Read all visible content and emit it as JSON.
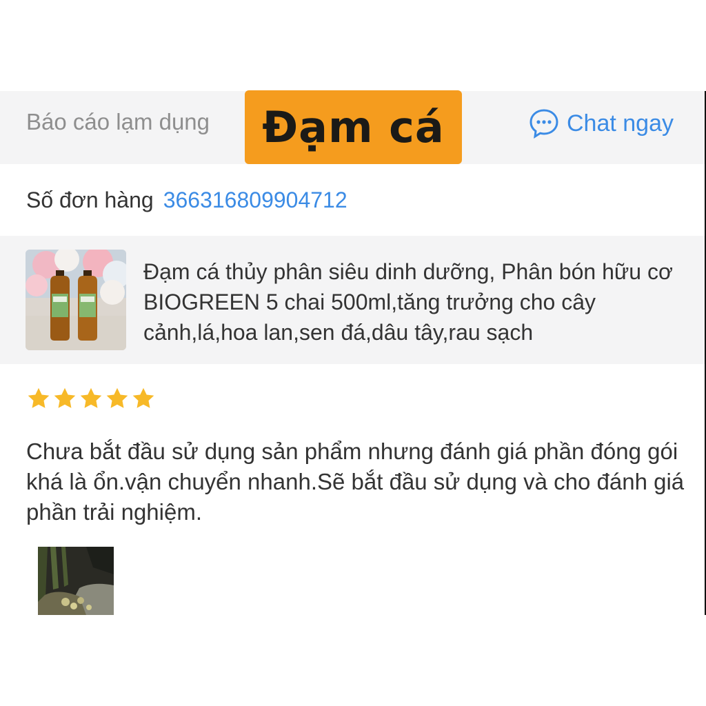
{
  "header": {
    "report_label": "Báo cáo lạm dụng",
    "chat_label": "Chat ngay",
    "chat_icon": "chat-bubble-icon"
  },
  "overlay": {
    "tag_text": "Đạm cá",
    "tag_color": "#f59c1e"
  },
  "order": {
    "label": "Số đơn hàng",
    "number": "366316809904712"
  },
  "product": {
    "title": "Đạm cá thủy phân siêu dinh dưỡng, Phân bón hữu cơ BIOGREEN 5 chai 500ml,tăng trưởng cho cây cảnh,lá,hoa lan,sen đá,dâu tây,rau sạch",
    "thumbnail": "product-bottles-image"
  },
  "review": {
    "stars": 5,
    "star_color": "#f7b928",
    "text": "Chưa bắt đầu sử dụng sản phẩm nhưng đánh giá phần đóng gói khá là ổn.vận chuyển nhanh.Sẽ bắt đầu sử dụng và cho đánh giá phần trải nghiệm.",
    "photo": "review-plant-photo"
  },
  "colors": {
    "accent_blue": "#3b8be5",
    "muted_gray": "#8e8e8e",
    "panel_bg": "#f4f4f5"
  }
}
